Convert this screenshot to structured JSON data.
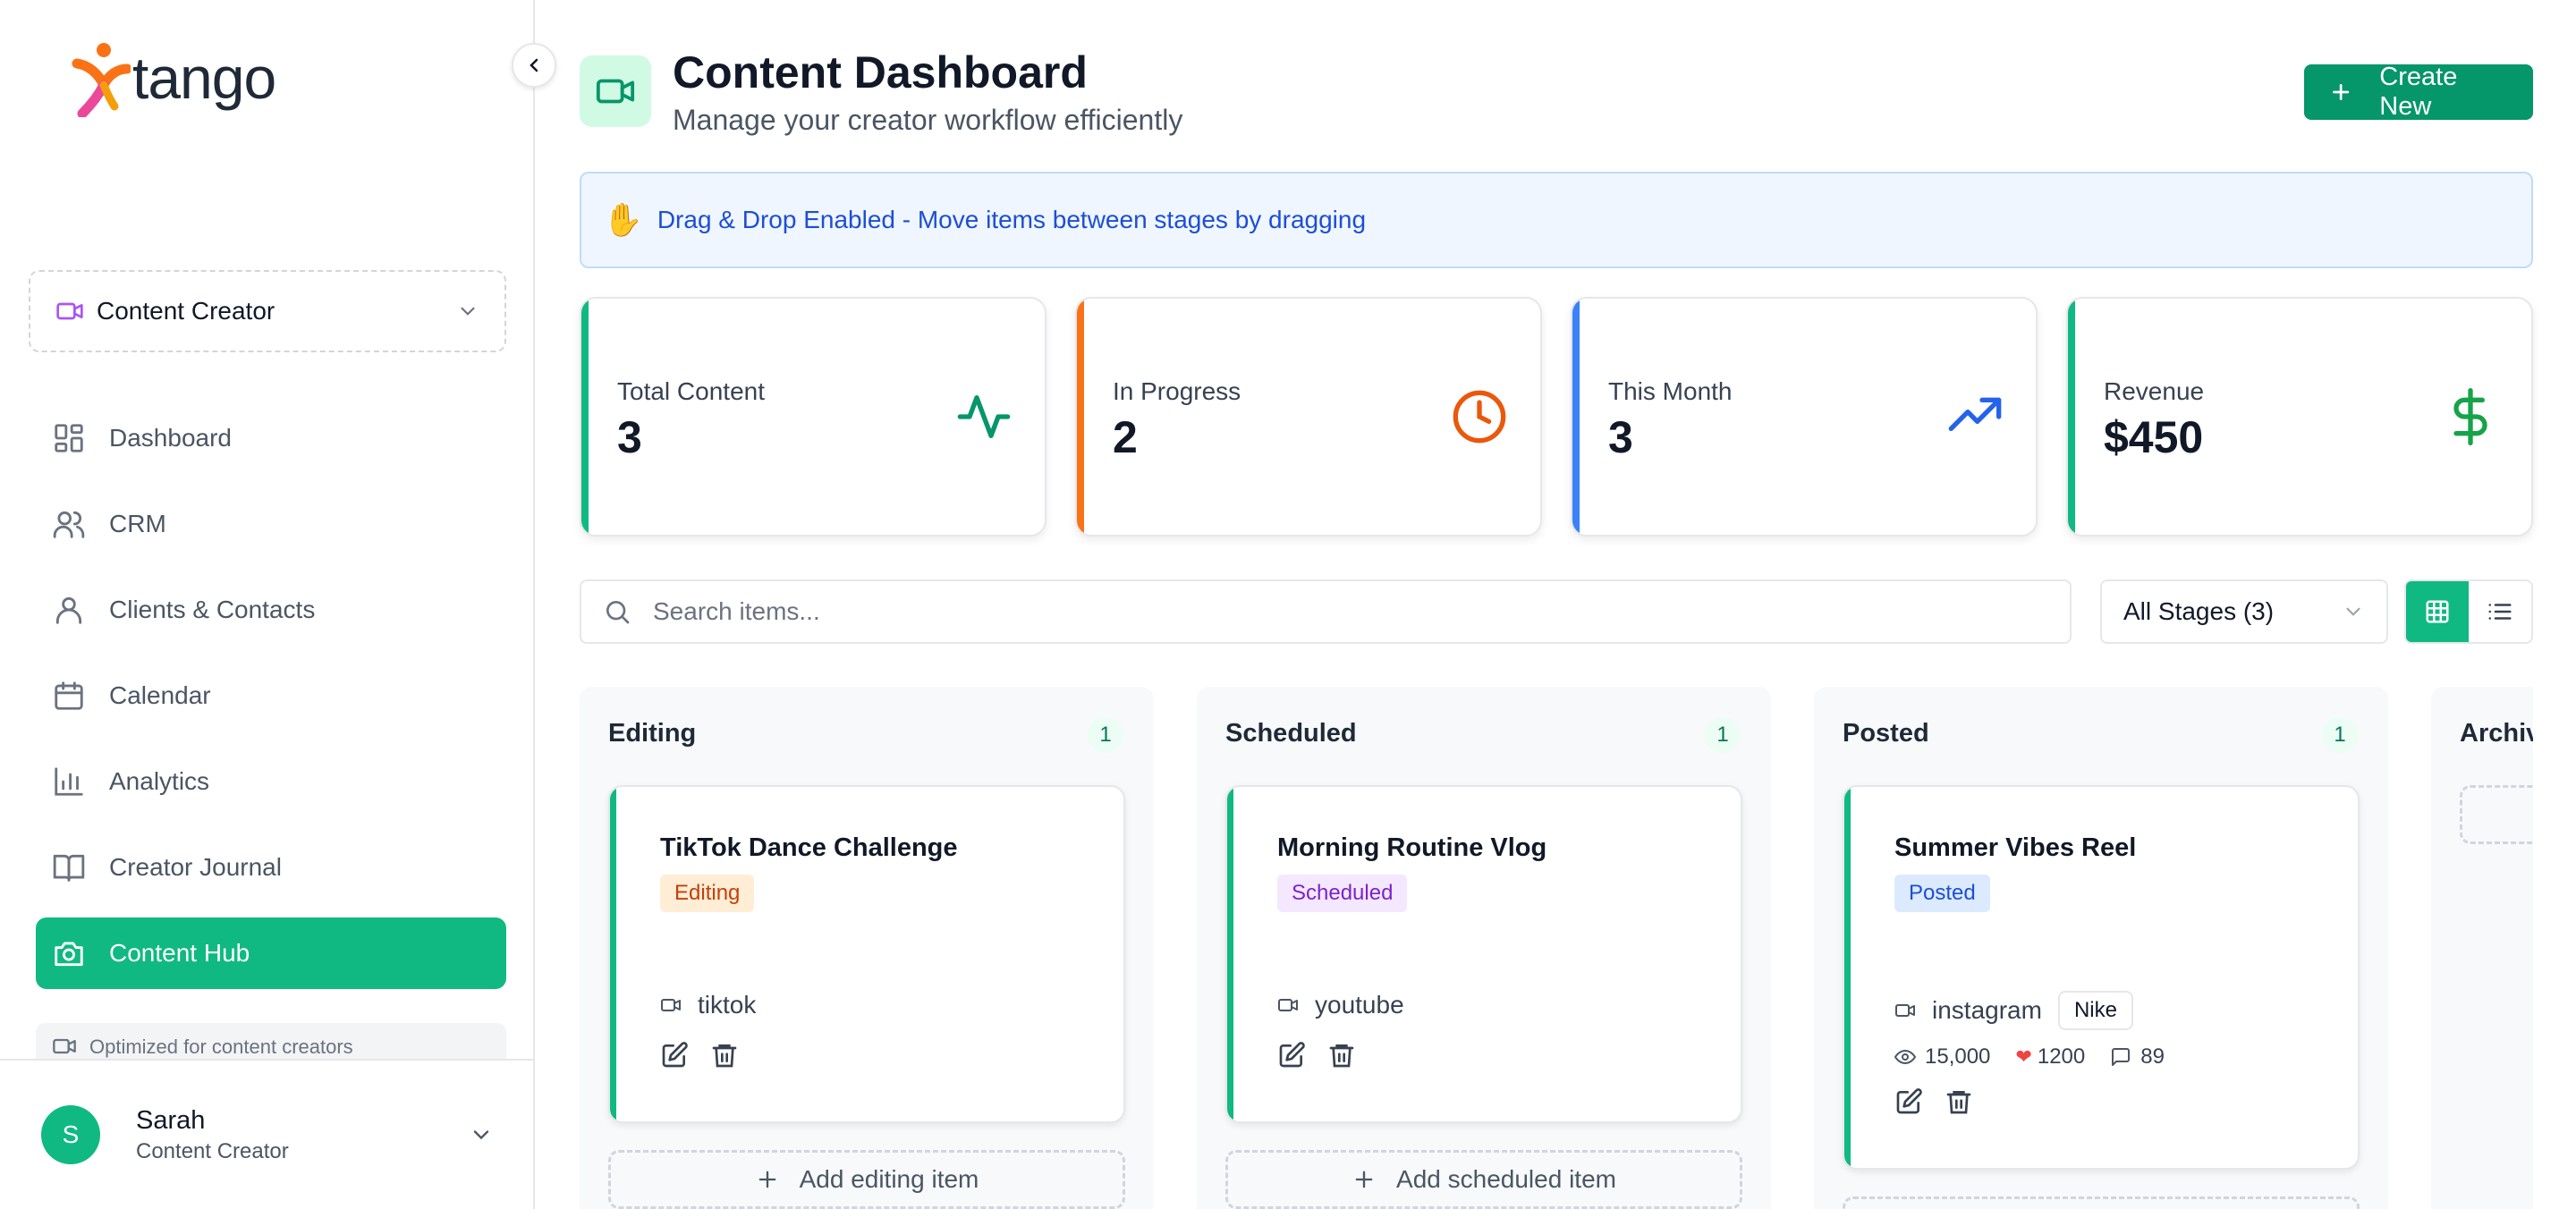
{
  "app": {
    "logo_text": "tango"
  },
  "sidebar": {
    "role": "Content Creator",
    "items": [
      {
        "label": "Dashboard",
        "icon": "dashboard-icon"
      },
      {
        "label": "CRM",
        "icon": "users-icon"
      },
      {
        "label": "Clients & Contacts",
        "icon": "user-icon"
      },
      {
        "label": "Calendar",
        "icon": "calendar-icon"
      },
      {
        "label": "Analytics",
        "icon": "bar-chart-icon"
      },
      {
        "label": "Creator Journal",
        "icon": "book-icon"
      },
      {
        "label": "Content Hub",
        "icon": "camera-icon",
        "active": true
      }
    ],
    "note": "Optimized for content creators",
    "user": {
      "initial": "S",
      "name": "Sarah",
      "role": "Content Creator"
    }
  },
  "header": {
    "title": "Content Dashboard",
    "subtitle": "Manage your creator workflow efficiently",
    "create_label": "Create New"
  },
  "banner": {
    "emoji": "✋",
    "text": "Drag & Drop Enabled - Move items between stages by dragging"
  },
  "stats": [
    {
      "label": "Total Content",
      "value": "3",
      "color": "#10b981",
      "icon": "activity-icon"
    },
    {
      "label": "In Progress",
      "value": "2",
      "color": "#f97316",
      "icon": "clock-icon"
    },
    {
      "label": "This Month",
      "value": "3",
      "color": "#3b82f6",
      "icon": "trending-up-icon"
    },
    {
      "label": "Revenue",
      "value": "$450",
      "color": "#10b981",
      "icon": "dollar-icon"
    }
  ],
  "filters": {
    "search_placeholder": "Search items...",
    "stage_select": "All Stages (3)"
  },
  "columns": [
    {
      "name": "Editing",
      "count": "1",
      "card": {
        "title": "TikTok Dance Challenge",
        "status": "Editing",
        "platform": "tiktok"
      },
      "add_label": "Add editing item"
    },
    {
      "name": "Scheduled",
      "count": "1",
      "card": {
        "title": "Morning Routine Vlog",
        "status": "Scheduled",
        "platform": "youtube"
      },
      "add_label": "Add scheduled item"
    },
    {
      "name": "Posted",
      "count": "1",
      "card": {
        "title": "Summer Vibes Reel",
        "status": "Posted",
        "platform": "instagram",
        "brand": "Nike",
        "views": "15,000",
        "likes": "1200",
        "comments": "89"
      },
      "add_label": ""
    },
    {
      "name": "Archived"
    }
  ]
}
